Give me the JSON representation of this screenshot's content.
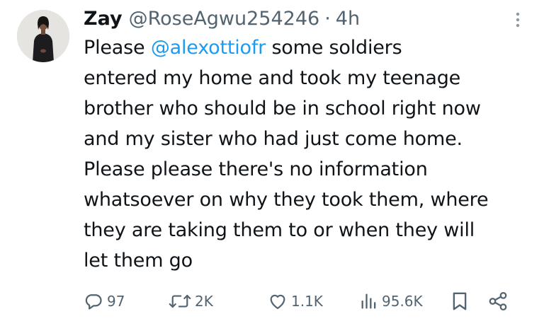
{
  "user": {
    "display_name": "Zay",
    "handle": "@RoseAgwu254246",
    "separator": "·",
    "time": "4h",
    "avatar_icon": "profile-photo"
  },
  "tweet": {
    "lines": [
      {
        "prefix": "Please ",
        "mention": "@alexottiofr",
        "suffix": " some soldiers"
      },
      {
        "text": "entered my home and took my teenage"
      },
      {
        "text": "brother who should be in school right now"
      },
      {
        "text": "and my sister who had just come home."
      },
      {
        "text": "Please please there's no information"
      },
      {
        "text": "whatsoever on why they took them, where"
      },
      {
        "text": "they are taking them to or when they will"
      },
      {
        "text": "let them go"
      }
    ]
  },
  "actions": {
    "replies": "97",
    "reposts": "2K",
    "likes": "1.1K",
    "views": "95.6K"
  },
  "colors": {
    "text": "#0f1419",
    "secondary": "#536471",
    "mention": "#1d9bf0"
  },
  "icons": [
    "reply-icon",
    "repost-icon",
    "like-icon",
    "views-icon",
    "bookmark-icon",
    "share-icon",
    "more-icon"
  ]
}
